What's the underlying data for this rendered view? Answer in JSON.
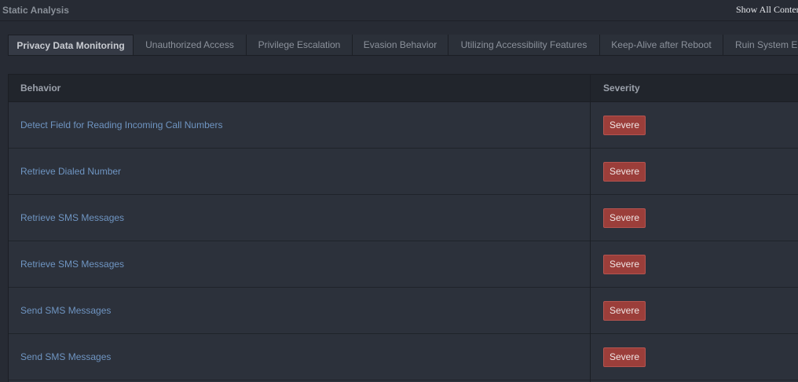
{
  "header": {
    "title": "Static Analysis",
    "show_all": "Show All Conter"
  },
  "tabs": [
    {
      "label": "Privacy Data Monitoring",
      "active": true
    },
    {
      "label": "Unauthorized Access",
      "active": false
    },
    {
      "label": "Privilege Escalation",
      "active": false
    },
    {
      "label": "Evasion Behavior",
      "active": false
    },
    {
      "label": "Utilizing Accessibility Features",
      "active": false
    },
    {
      "label": "Keep-Alive after Reboot",
      "active": false
    },
    {
      "label": "Ruin System Er",
      "active": false
    }
  ],
  "table": {
    "columns": [
      "Behavior",
      "Severity"
    ],
    "rows": [
      {
        "behavior": "Detect Field for Reading Incoming Call Numbers",
        "severity": "Severe"
      },
      {
        "behavior": "Retrieve Dialed Number",
        "severity": "Severe"
      },
      {
        "behavior": "Retrieve SMS Messages",
        "severity": "Severe"
      },
      {
        "behavior": "Retrieve SMS Messages",
        "severity": "Severe"
      },
      {
        "behavior": "Send SMS Messages",
        "severity": "Severe"
      },
      {
        "behavior": "Send SMS Messages",
        "severity": "Severe"
      }
    ]
  },
  "colors": {
    "background": "#272b34",
    "link": "#6f95c2",
    "severe_badge": "#9b3e3a"
  }
}
